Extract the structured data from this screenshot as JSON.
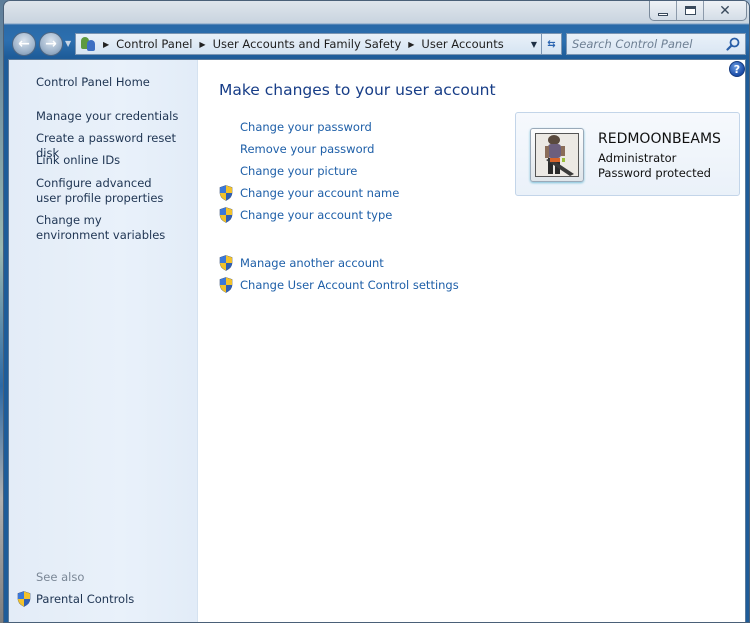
{
  "window": {
    "caption_buttons": {
      "minimize": "minimize",
      "maximize": "maximize",
      "close": "✕"
    }
  },
  "navbar": {
    "back_glyph": "←",
    "forward_glyph": "→",
    "breadcrumbs": [
      {
        "label": "Control Panel"
      },
      {
        "label": "User Accounts and Family Safety"
      },
      {
        "label": "User Accounts"
      }
    ],
    "refresh_glyph": "⇆",
    "search_placeholder": "Search Control Panel"
  },
  "sidebar": {
    "home_label": "Control Panel Home",
    "links": [
      {
        "label": "Manage your credentials"
      },
      {
        "label": "Create a password reset disk"
      },
      {
        "label": "Link online IDs"
      },
      {
        "label": "Configure advanced user profile properties"
      },
      {
        "label": "Change my environment variables"
      }
    ],
    "see_also_label": "See also",
    "see_also_links": [
      {
        "label": "Parental Controls",
        "icon": "uac-shield-icon"
      }
    ]
  },
  "main": {
    "title": "Make changes to your user account",
    "help_glyph": "?",
    "tasks": [
      {
        "label": "Change your password",
        "shield": false
      },
      {
        "label": "Remove your password",
        "shield": false
      },
      {
        "label": "Change your picture",
        "shield": false
      },
      {
        "label": "Change your account name",
        "shield": true
      },
      {
        "label": "Change your account type",
        "shield": true
      }
    ],
    "other_tasks": [
      {
        "label": "Manage another account",
        "shield": true
      },
      {
        "label": "Change User Account Control settings",
        "shield": true
      }
    ]
  },
  "user": {
    "name": "REDMOONBEAMS",
    "role": "Administrator",
    "status": "Password protected"
  },
  "colors": {
    "link": "#1e5fa8",
    "title": "#173d87",
    "sidebar_bg": "#e7effa",
    "chrome": "#2a6aa8"
  }
}
